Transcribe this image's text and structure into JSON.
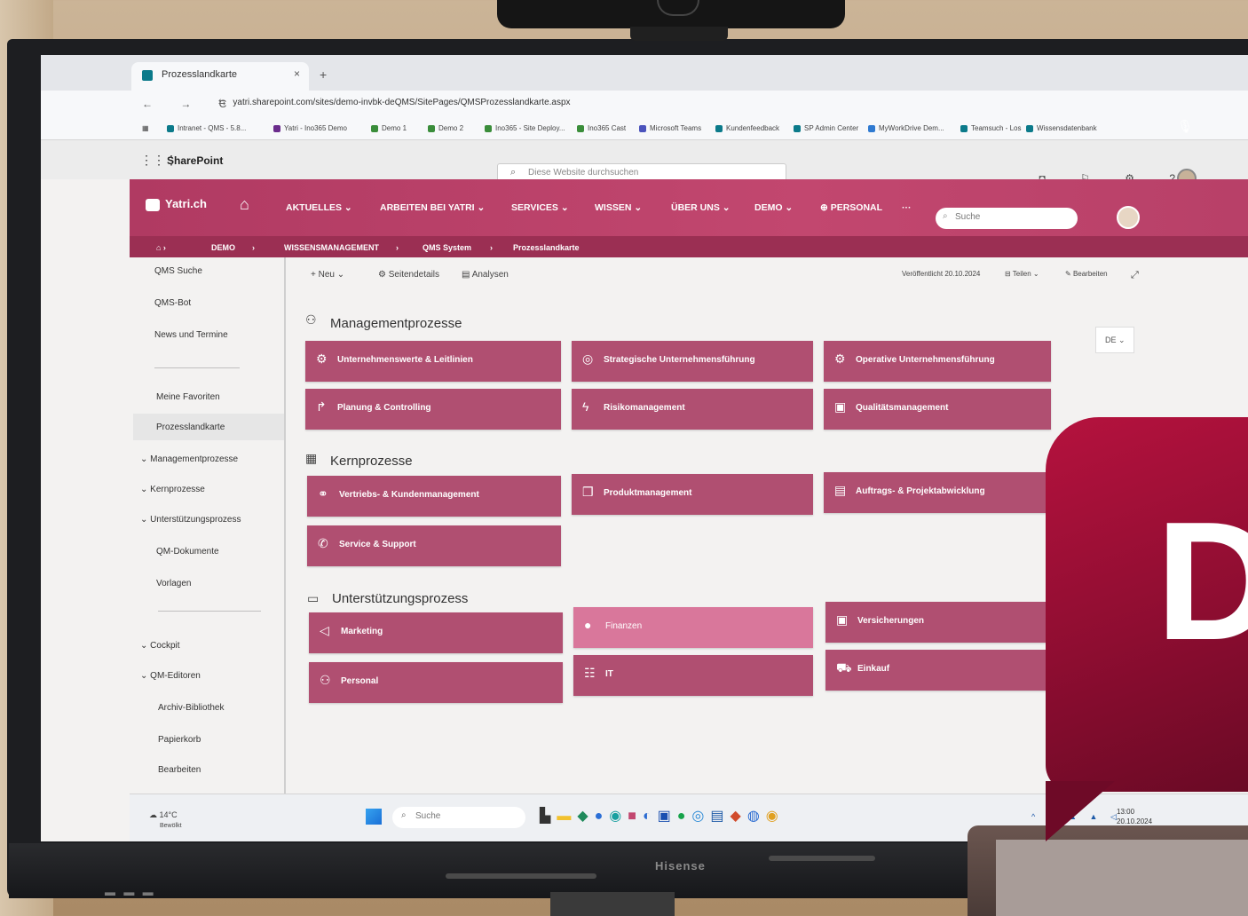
{
  "browser": {
    "tab_title": "Prozesslandkarte",
    "new_tab": "+",
    "tab_close": "×",
    "nav_buttons": "← → C",
    "url": "yatri.sharepoint.com/sites/demo-invbk-deQMS/SitePages/QMSProzesslandkarte.aspx",
    "window_controls": "– ▫ ×",
    "bookmarks": [
      "Intranet - QMS - 5.8...",
      "Yatri - Ino365 Demo",
      "Demo 1",
      "Demo 2",
      "Ino365 - Site Deploy...",
      "Ino365 Cast",
      "Microsoft Teams",
      "Kundenfeedback",
      "SP Admin Center",
      "MyWorkDrive Dem...",
      "Teamsuch - Los",
      "Wissensdatenbank"
    ]
  },
  "suitebar": {
    "title": "SharePoint",
    "search_placeholder": "Diese Website durchsuchen"
  },
  "site": {
    "logo": "Yatri.ch",
    "nav": [
      "AKTUELLES ⌄",
      "ARBEITEN BEI YATRI ⌄",
      "SERVICES ⌄",
      "WISSEN ⌄",
      "ÜBER UNS ⌄",
      "DEMO ⌄",
      "PERSONAL",
      "···"
    ],
    "search_placeholder": "Suche",
    "breadcrumb": [
      "DEMO",
      "WISSENSMANAGEMENT",
      "QMS System",
      "Prozesslandkarte"
    ]
  },
  "leftnav": {
    "items": [
      "QMS Suche",
      "QMS-Bot",
      "News und Termine",
      "Meine Favoriten",
      "Prozesslandkarte",
      "Managementprozesse",
      "Kernprozesse",
      "Unterstützungsprozess",
      "QM-Dokumente",
      "Vorlagen",
      "Cockpit",
      "QM-Editoren",
      "Archiv-Bibliothek",
      "Papierkorb",
      "Bearbeiten"
    ]
  },
  "commandbar": {
    "new": "+ Neu ⌄",
    "page_details": "Seitendetails",
    "analytics": "Analysen",
    "published": "Veröffentlicht 20.10.2024",
    "share": "Teilen ⌄",
    "edit": "Bearbeiten"
  },
  "language": "DE ⌄",
  "sections": {
    "management": {
      "title": "Managementprozesse",
      "tiles": [
        "Unternehmenswerte & Leitlinien",
        "Strategische Unternehmensführung",
        "Operative Unternehmensführung",
        "Planung & Controlling",
        "Risikomanagement",
        "Qualitätsmanagement"
      ]
    },
    "core": {
      "title": "Kernprozesse",
      "tiles": [
        "Vertriebs- & Kundenmanagement",
        "Produktmanagement",
        "Auftrags- & Projektabwicklung",
        "Service & Support"
      ]
    },
    "support": {
      "title": "Unterstützungsprozess",
      "tiles": [
        "Marketing",
        "Finanzen",
        "Versicherungen",
        "Personal",
        "IT",
        "Einkauf"
      ]
    }
  },
  "taskbar": {
    "weather_temp": "14°C",
    "weather_text": "Bewölkt",
    "search_placeholder": "Suche",
    "time": "13:00",
    "date": "20.10.2024"
  },
  "tv_brand": "Hisense",
  "badge_letter": "D",
  "colors": {
    "header_pink": "#c2476f",
    "tile": "#b04f71",
    "tile_highlight": "#d9779b",
    "badge": "#9e1036"
  }
}
